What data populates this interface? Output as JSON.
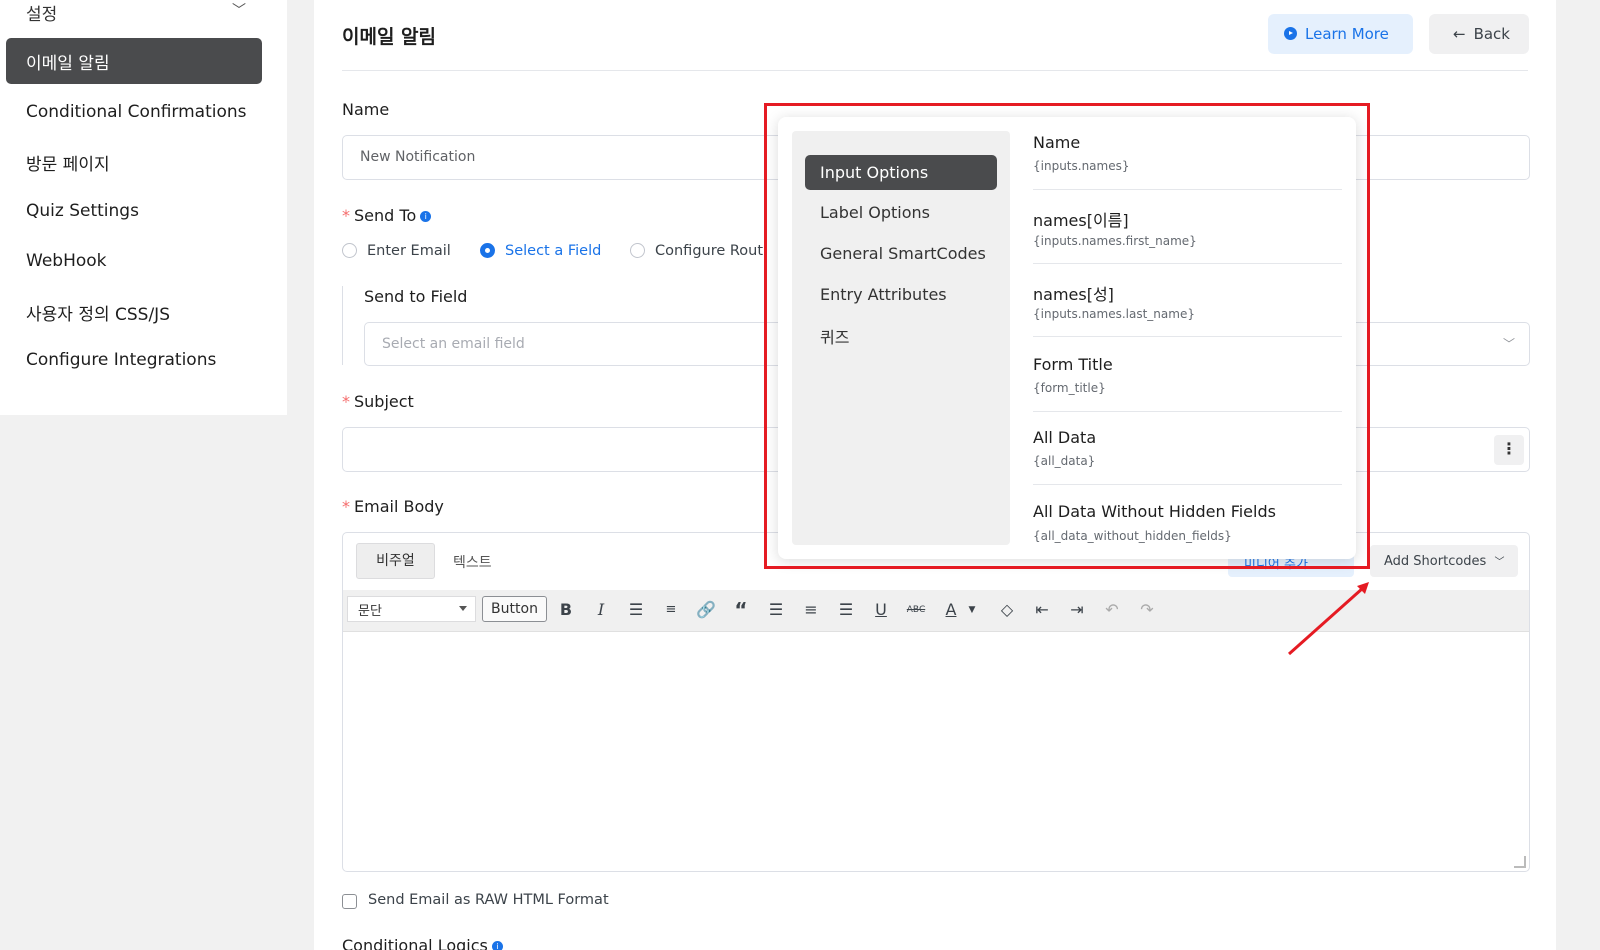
{
  "sidebar": {
    "top_label": "설정",
    "active": "이메일 알림",
    "items": [
      "Conditional Confirmations",
      "방문 페이지",
      "Quiz Settings",
      "WebHook",
      "사용자 정의 CSS/JS",
      "Configure Integrations"
    ]
  },
  "header": {
    "title": "이메일 알림",
    "learn_more": "Learn More",
    "back": "Back"
  },
  "form": {
    "name_label": "Name",
    "name_value": "New Notification",
    "send_to_label": "Send To",
    "radio_enter_email": "Enter Email",
    "radio_select_field": "Select a Field",
    "radio_configure_routing": "Configure Routi",
    "send_to_field_label": "Send to Field",
    "send_to_field_placeholder": "Select an email field",
    "subject_label": "Subject",
    "email_body_label": "Email Body"
  },
  "editor": {
    "tab_visual": "비주얼",
    "tab_text": "텍스트",
    "media_button": "미디어 추가",
    "shortcodes_button": "Add Shortcodes",
    "format_select": "문단",
    "button_label": "Button"
  },
  "raw_html_label": "Send Email as RAW HTML Format",
  "conditional_logics_label": "Conditional Logics",
  "popover": {
    "categories": [
      "Input Options",
      "Label Options",
      "General SmartCodes",
      "Entry Attributes",
      "퀴즈"
    ],
    "items": [
      {
        "name": "Name",
        "code": "{inputs.names}"
      },
      {
        "name": "names[이름]",
        "code": "{inputs.names.first_name}"
      },
      {
        "name": "names[성]",
        "code": "{inputs.names.last_name}"
      },
      {
        "name": "Form Title",
        "code": "{form_title}"
      },
      {
        "name": "All Data",
        "code": "{all_data}"
      },
      {
        "name": "All Data Without Hidden Fields",
        "code": "{all_data_without_hidden_fields}"
      }
    ]
  },
  "colors": {
    "accent": "#1a73e8",
    "dark_active": "#4a4b4d",
    "annotation_red": "#e51b23",
    "required": "#f56c6c"
  }
}
